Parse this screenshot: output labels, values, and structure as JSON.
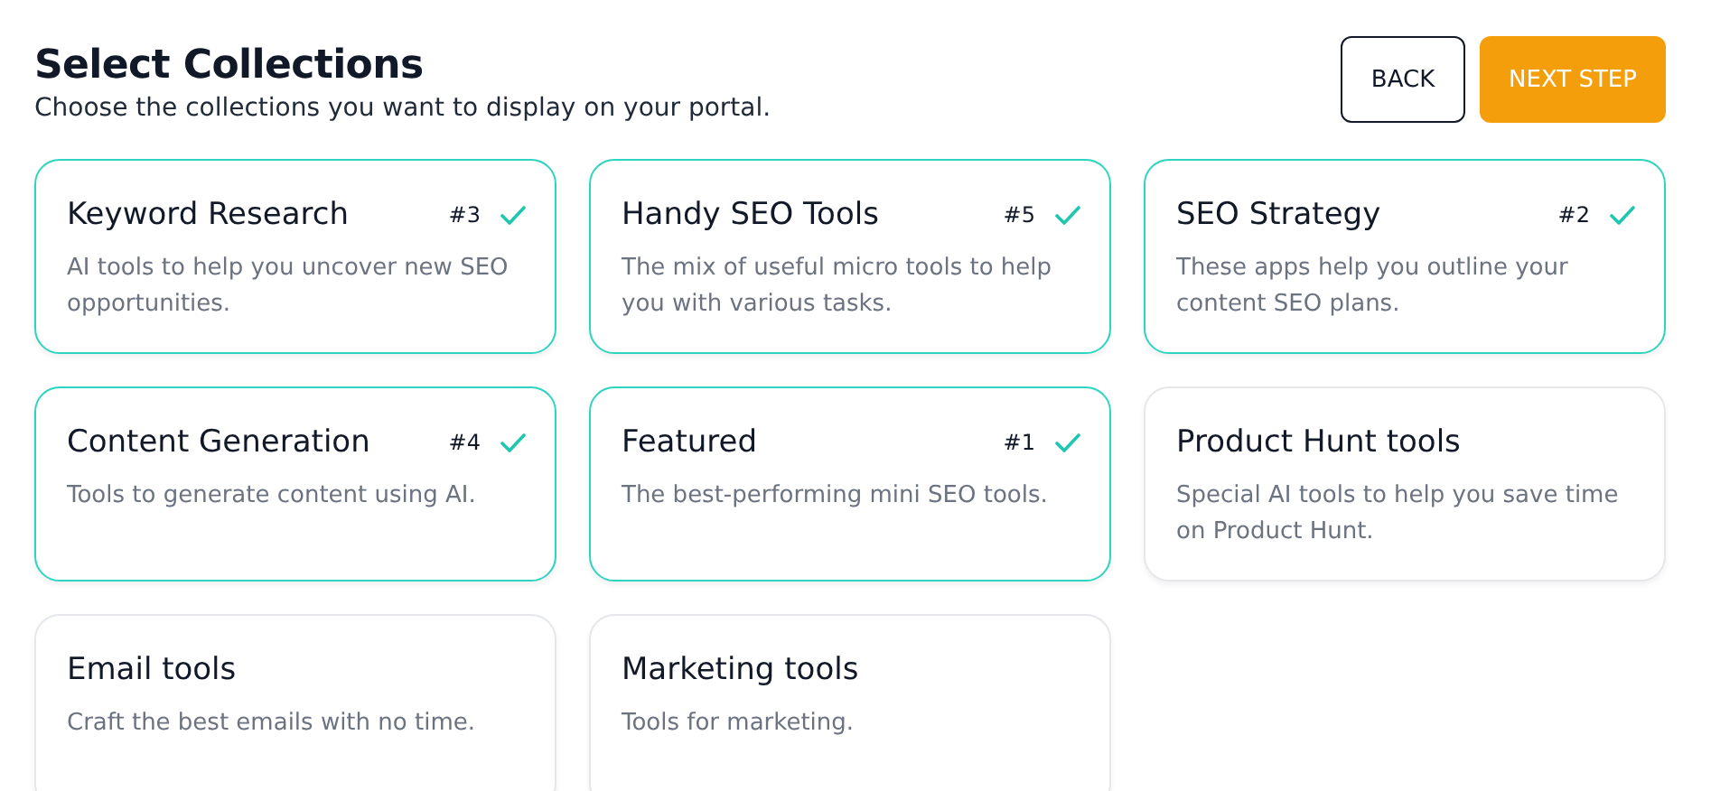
{
  "header": {
    "title": "Select Collections",
    "subtitle": "Choose the collections you want to display on your portal."
  },
  "buttons": [
    {
      "label": "BACK",
      "kind": "secondary"
    },
    {
      "label": "NEXT STEP",
      "kind": "primary"
    }
  ],
  "collections": [
    {
      "name": "Keyword Research",
      "description": "AI tools to help you uncover new SEO opportunities.",
      "selected": true,
      "order": "#3"
    },
    {
      "name": "Handy SEO Tools",
      "description": "The mix of useful micro tools to help you with various tasks.",
      "selected": true,
      "order": "#5"
    },
    {
      "name": "SEO Strategy",
      "description": "These apps help you outline your content SEO plans.",
      "selected": true,
      "order": "#2"
    },
    {
      "name": "Content Generation",
      "description": "Tools to generate content using AI.",
      "selected": true,
      "order": "#4"
    },
    {
      "name": "Featured",
      "description": "The best-performing mini SEO tools.",
      "selected": true,
      "order": "#1"
    },
    {
      "name": "Product Hunt tools",
      "description": "Special AI tools to help you save time on Product Hunt.",
      "selected": false
    },
    {
      "name": "Email tools",
      "description": "Craft the best emails with no time.",
      "selected": false
    },
    {
      "name": "Marketing tools",
      "description": "Tools for marketing.",
      "selected": false
    }
  ]
}
